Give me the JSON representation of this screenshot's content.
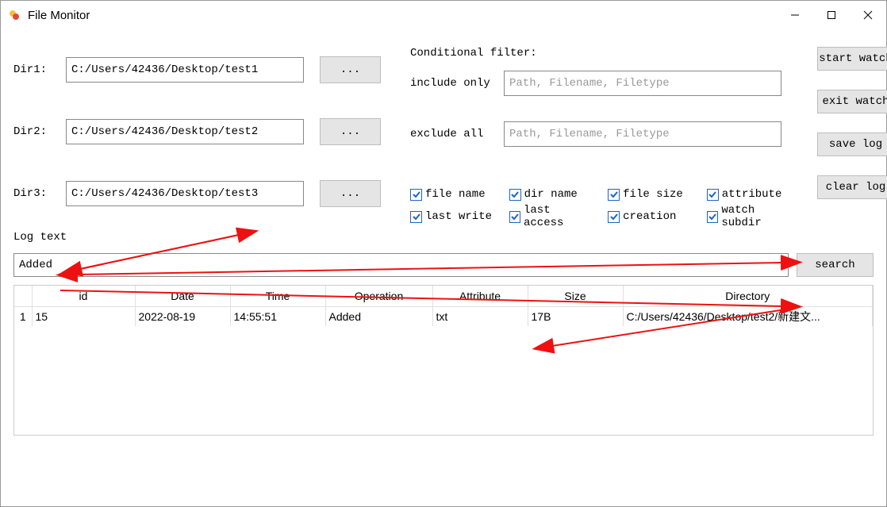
{
  "window": {
    "title": "File Monitor"
  },
  "dirs": {
    "label1": "Dir1:",
    "label2": "Dir2:",
    "label3": "Dir3:",
    "val1": "C:/Users/42436/Desktop/test1",
    "val2": "C:/Users/42436/Desktop/test2",
    "val3": "C:/Users/42436/Desktop/test3",
    "browse": "..."
  },
  "filter": {
    "title": "Conditional filter:",
    "include_label": "include only",
    "exclude_label": "exclude  all",
    "placeholder": "Path, Filename, Filetype"
  },
  "checks": {
    "file_name": "file name",
    "dir_name": "dir name",
    "file_size": "file size",
    "attribute": "attribute",
    "last_write": "last write",
    "last_access": "last access",
    "creation": "creation",
    "watch_subdir": "watch subdir"
  },
  "actions": {
    "start": "start watch",
    "exit": "exit watch",
    "save": "save log",
    "clear": "clear log"
  },
  "log": {
    "label": "Log text",
    "search_value": "Added",
    "search_btn": "search"
  },
  "table": {
    "headers": {
      "idx": "",
      "id": "id",
      "date": "Date",
      "time": "Time",
      "op": "Operation",
      "attr": "Attribute",
      "size": "Size",
      "dir": "Directory"
    },
    "rows": [
      {
        "idx": "1",
        "id": "15",
        "date": "2022-08-19",
        "time": "14:55:51",
        "op": "Added",
        "attr": "txt",
        "size": "17B",
        "dir": "C:/Users/42436/Desktop/test2/新建文..."
      }
    ]
  }
}
